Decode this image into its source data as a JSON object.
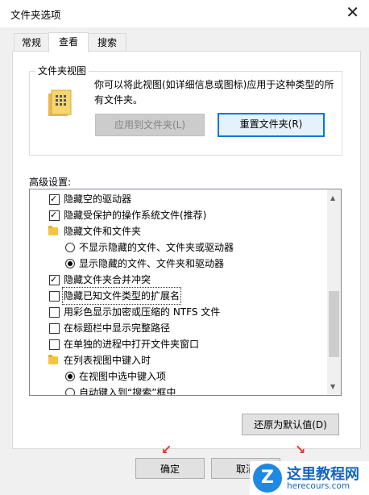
{
  "window": {
    "title": "文件夹选项"
  },
  "tabs": [
    {
      "label": "常规"
    },
    {
      "label": "查看"
    },
    {
      "label": "搜索"
    }
  ],
  "folder_views": {
    "group_label": "文件夹视图",
    "description": "你可以将此视图(如详细信息或图标)应用于这种类型的所有文件夹。",
    "apply_button": "应用到文件夹(L)",
    "reset_button": "重置文件夹(R)"
  },
  "advanced": {
    "label": "高级设置:",
    "items": [
      {
        "type": "checkbox",
        "checked": true,
        "label": "隐藏空的驱动器"
      },
      {
        "type": "checkbox",
        "checked": true,
        "label": "隐藏受保护的操作系统文件(推荐)"
      },
      {
        "type": "folder",
        "label": "隐藏文件和文件夹"
      },
      {
        "type": "radio",
        "checked": false,
        "label": "不显示隐藏的文件、文件夹或驱动器"
      },
      {
        "type": "radio",
        "checked": true,
        "label": "显示隐藏的文件、文件夹和驱动器"
      },
      {
        "type": "checkbox",
        "checked": true,
        "label": "隐藏文件夹合并冲突"
      },
      {
        "type": "checkbox",
        "checked": false,
        "label": "隐藏已知文件类型的扩展名"
      },
      {
        "type": "checkbox",
        "checked": false,
        "label": "用彩色显示加密或压缩的 NTFS 文件"
      },
      {
        "type": "checkbox",
        "checked": false,
        "label": "在标题栏中显示完整路径"
      },
      {
        "type": "checkbox",
        "checked": false,
        "label": "在单独的进程中打开文件夹窗口"
      },
      {
        "type": "folder",
        "label": "在列表视图中键入时"
      },
      {
        "type": "radio",
        "checked": true,
        "label": "在视图中选中键入项"
      },
      {
        "type": "radio",
        "checked": false,
        "label": "自动键入到“搜索”框中"
      }
    ],
    "restore_button": "还原为默认值(D)"
  },
  "footer": {
    "ok_button": "确定",
    "cancel_button": "取消"
  },
  "watermark": {
    "logo_letter": "Z",
    "name": "这里教程网",
    "url": "herecours.com"
  },
  "colors": {
    "accent": "#0078d7",
    "annotation": "#e53935",
    "logo": "#1565c0"
  }
}
